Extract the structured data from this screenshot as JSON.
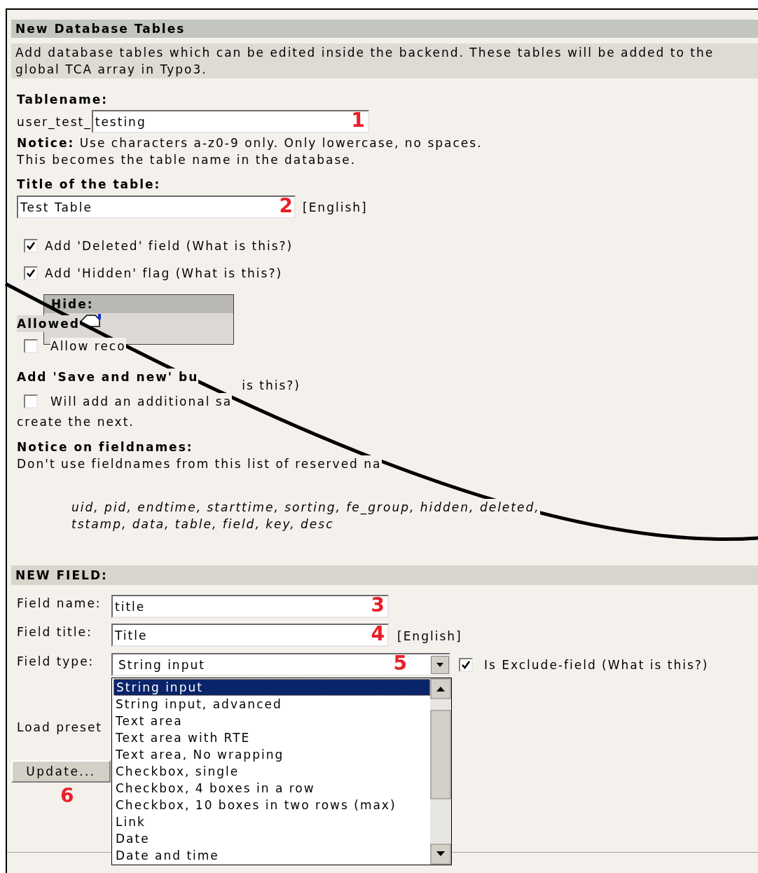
{
  "section_title": "New Database Tables",
  "description": "Add database tables which can be edited inside the backend. These tables will be added to the global TCA array in Typo3.",
  "tablename": {
    "label": "Tablename:",
    "prefix": "user_test_",
    "value": "testing",
    "marker": "1"
  },
  "notice_lines": [
    "**Notice:** Use characters a-z0-9 only. Only lowercase, no spaces.",
    "This becomes the table name in the database."
  ],
  "table_title": {
    "label": "Title of the table:",
    "value": "Test Table",
    "marker": "2",
    "language": "[English]"
  },
  "options": [
    {
      "label": "Add 'Deleted' field (What is this?)",
      "checked": true
    },
    {
      "label": "Add 'Hidden' flag (What is this?)",
      "checked": true
    }
  ],
  "tooltip": {
    "title": "Hide:"
  },
  "allowed": {
    "label": "Allowed",
    "checkbox_label": "Allow reco",
    "checked": false
  },
  "save_and_new": {
    "label": "Add 'Save and new' bu",
    "label_tail": "is this?)",
    "checkbox_label": "Will add an additional sa",
    "checked": false,
    "continuation": "create the next."
  },
  "fieldnames_notice": {
    "label": "Notice on fieldnames:",
    "text": "Don't use fieldnames from this list of reserved na",
    "reserved": [
      "uid, pid, endtime, starttime, sorting, fe_group, hidden, deleted,",
      "tstamp, data, table, field, key, desc"
    ]
  },
  "new_field": {
    "title": "NEW FIELD:",
    "name": {
      "label": "Field name:",
      "value": "title",
      "marker": "3"
    },
    "field_title": {
      "label": "Field title:",
      "value": "Title",
      "marker": "4",
      "language": "[English]"
    },
    "type": {
      "label": "Field type:",
      "value": "String input",
      "marker": "5"
    },
    "exclude": {
      "label": "Is Exclude-field (What is this?)",
      "checked": true
    },
    "type_options": [
      {
        "label": "String input",
        "selected": true
      },
      {
        "label": "String input, advanced",
        "selected": false
      },
      {
        "label": "Text area",
        "selected": false
      },
      {
        "label": "Text area with RTE",
        "selected": false
      },
      {
        "label": "Text area, No wrapping",
        "selected": false
      },
      {
        "label": "Checkbox, single",
        "selected": false
      },
      {
        "label": "Checkbox, 4 boxes in a row",
        "selected": false
      },
      {
        "label": "Checkbox, 10 boxes in two rows (max)",
        "selected": false
      },
      {
        "label": "Link",
        "selected": false
      },
      {
        "label": "Date",
        "selected": false
      },
      {
        "label": "Date and time",
        "selected": false
      }
    ],
    "load_preset_label": "Load preset",
    "update_button": "Update...",
    "update_marker": "6"
  }
}
